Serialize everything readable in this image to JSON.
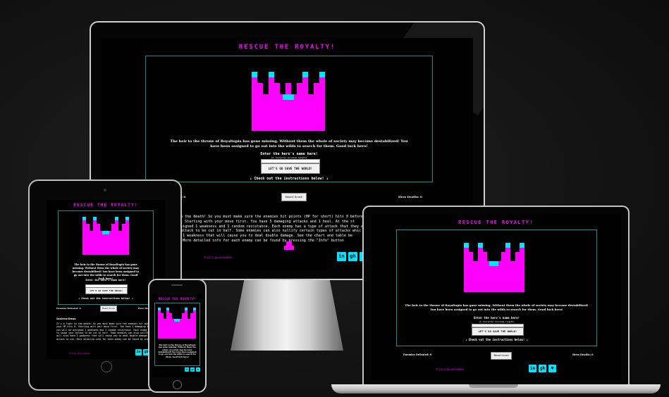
{
  "game": {
    "title": "RESCUE THE ROYALTY!",
    "intro": "The heir to the throne of Royaltopia has gone missing. Without them the whole of society may become destabilized! You have been assigned to go out into the wilds to search for them. Good luck hero!",
    "name_prompt": "Enter the hero's name here!",
    "name_hint": "(5 character minimum length)",
    "start_button": "LET'S GO SAVE THE WORLD!",
    "instructions_link": "↓ Check out the instructions below! ↓",
    "enemies_defeated_label": "Enemies Defeated: 0",
    "reset_button": "Reset Score",
    "hero_deaths_label": "Hero Deaths: 0",
    "copyright": "©2022 Jacob Walsh",
    "instructions_heading": "Instructions",
    "instructions_lines": [
      "It's a fight to the death! So you must make sure the enemies hit points (HP for short) hits 0 before",
      "your HP hits 0. Starting with your move first. You have 5 damaging attacks and 1 heal. At the st",
      "you will be assigned 1 weakness and 1 random resistance. Each enemy has a type of attack that they are re",
      "to cause your attack to be cut in half. Some enemies can also nullify certain types of attacks whic",
      "will also have 1 weakness that will cause you to deal double damage. See the chart and table be",
      "attack to use. More detailed info for each enemy can be found by pressing the \"Info\" button"
    ],
    "social": [
      "in",
      "gh",
      "♥"
    ]
  },
  "icons": {
    "crown": "crown-pixel-icon",
    "linkedin": "linkedin-icon",
    "github": "github-icon",
    "heart": "heart-icon",
    "hero": "hero-pixel-icon"
  },
  "colors": {
    "accent": "#ff00ff",
    "secondary": "#00e5ff",
    "border": "#1a8a8a",
    "background": "#000000"
  }
}
